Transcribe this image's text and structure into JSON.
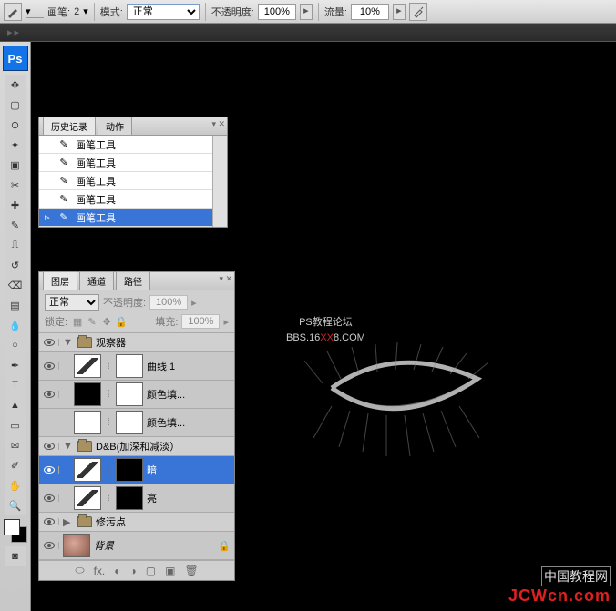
{
  "options_bar": {
    "brush_label": "画笔:",
    "brush_size": "2",
    "mode_label": "模式:",
    "mode_value": "正常",
    "opacity_label": "不透明度:",
    "opacity_value": "100%",
    "flow_label": "流量:",
    "flow_value": "10%"
  },
  "ps_logo": "Ps",
  "history_panel": {
    "tabs": [
      "历史记录",
      "动作"
    ],
    "items": [
      "画笔工具",
      "画笔工具",
      "画笔工具",
      "画笔工具",
      "画笔工具"
    ],
    "selected_index": 4
  },
  "layers_panel": {
    "tabs": [
      "图层",
      "通道",
      "路径"
    ],
    "blend_mode": "正常",
    "opacity_label": "不透明度:",
    "opacity_value": "100%",
    "lock_label": "锁定:",
    "fill_label": "填充:",
    "fill_value": "100%",
    "groups": [
      {
        "name": "观察器"
      },
      {
        "name": "D&B(加深和减淡）"
      },
      {
        "name": "修污点"
      }
    ],
    "layers": {
      "curves": "曲线 1",
      "colorfill1": "颜色填...",
      "colorfill2": "颜色填...",
      "dark": "暗",
      "light": "亮",
      "bg": "背景"
    }
  },
  "canvas": {
    "line1": "PS教程论坛",
    "bbs_prefix": "BBS.16",
    "bbs_mid": "XX",
    "bbs_suffix": "8.COM"
  },
  "watermark": {
    "cn": "中国教程网",
    "url": "JCWcn.com"
  }
}
